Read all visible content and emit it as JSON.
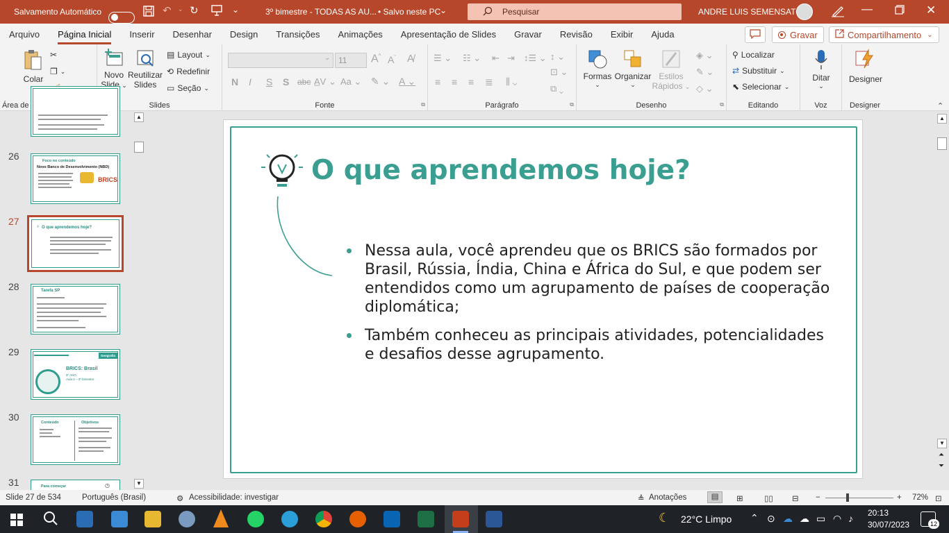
{
  "titlebar": {
    "autosave_label": "Salvamento Automático",
    "doc_title": "3º bimestre - TODAS AS AU...",
    "saved_status": "• Salvo neste PC",
    "search_placeholder": "Pesquisar",
    "user_name": "ANDRE LUIS SEMENSATO"
  },
  "menu": {
    "tabs": [
      "Arquivo",
      "Página Inicial",
      "Inserir",
      "Desenhar",
      "Design",
      "Transições",
      "Animações",
      "Apresentação de Slides",
      "Gravar",
      "Revisão",
      "Exibir",
      "Ajuda"
    ],
    "active_tab": "Página Inicial",
    "record_label": "Gravar",
    "share_label": "Compartilhamento"
  },
  "ribbon": {
    "clipboard": {
      "paste": "Colar",
      "group": "Área de Transferência"
    },
    "slides": {
      "new_slide_1": "Novo",
      "new_slide_2": "Slide",
      "reuse_1": "Reutilizar",
      "reuse_2": "Slides",
      "layout": "Layout",
      "reset": "Redefinir",
      "section": "Seção",
      "group": "Slides"
    },
    "font": {
      "size": "11",
      "bold": "N",
      "italic": "I",
      "underline": "S",
      "strike": "S",
      "group": "Fonte"
    },
    "paragraph": {
      "group": "Parágrafo"
    },
    "drawing": {
      "shapes": "Formas",
      "arrange": "Organizar",
      "styles_1": "Estilos",
      "styles_2": "Rápidos",
      "group": "Desenho"
    },
    "editing": {
      "find": "Localizar",
      "replace": "Substituir",
      "select": "Selecionar",
      "group": "Editando"
    },
    "voice": {
      "dictate": "Ditar",
      "group": "Voz"
    },
    "designer": {
      "label": "Designer",
      "group": "Designer"
    }
  },
  "thumbnails": [
    {
      "num": "26",
      "title": "Foco no conteúdo",
      "subtitle": "Novo Banco de Desenvolvimento (NBD)"
    },
    {
      "num": "27",
      "title": "O que aprendemos hoje?",
      "selected": true
    },
    {
      "num": "28",
      "title": "Tarefa SP"
    },
    {
      "num": "29",
      "title": "BRICS: Brasil",
      "subtitle": "9º ANO",
      "subtitle2": "Aula 3 – 3º bimestre",
      "badge": "Geografia"
    },
    {
      "num": "30",
      "title": "Conteúdo",
      "title2": "Objetivos"
    },
    {
      "num": "31",
      "title": "Para começar"
    }
  ],
  "slide": {
    "title": "O que aprendemos hoje?",
    "bullets": [
      "Nessa aula, você aprendeu que os BRICS são formados por Brasil, Rússia, Índia, China e África do Sul, e que podem ser entendidos como um agrupamento de países de cooperação diplomática;",
      "Também conheceu as principais atividades, potencialidades e desafios desse agrupamento."
    ],
    "accent": "#3a9e90"
  },
  "status": {
    "slide_info": "Slide 27 de 534",
    "language": "Português (Brasil)",
    "accessibility": "Acessibilidade: investigar",
    "notes": "Anotações",
    "zoom": "72%"
  },
  "taskbar": {
    "weather": "22°C  Limpo",
    "time": "20:13",
    "date": "30/07/2023",
    "notifications": "12"
  },
  "colors": {
    "brand": "#b7472a",
    "teal": "#3a9e90"
  }
}
